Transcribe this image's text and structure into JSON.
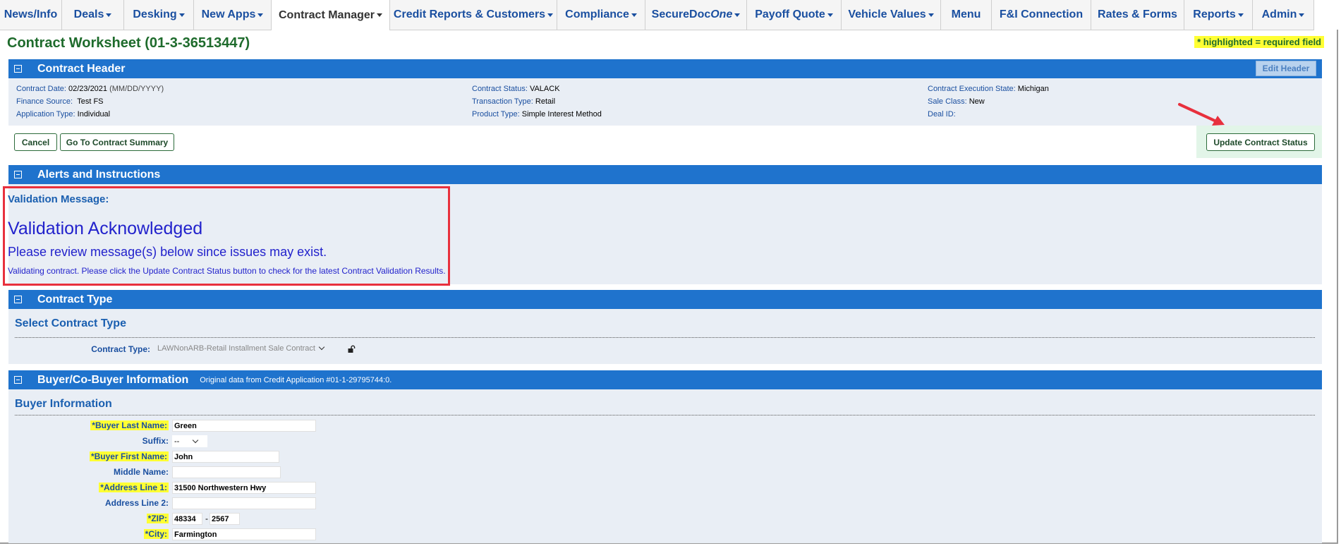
{
  "nav": {
    "items": [
      {
        "label": "News/Info",
        "caret": false
      },
      {
        "label": "Deals",
        "caret": true
      },
      {
        "label": "Desking",
        "caret": true
      },
      {
        "label": "New Apps",
        "caret": true
      },
      {
        "label": "Contract Manager",
        "caret": true,
        "active": true
      },
      {
        "label": "Credit Reports & Customers",
        "caret": true
      },
      {
        "label": "Compliance",
        "caret": true
      },
      {
        "label": "SecureDoc",
        "label_italic": "One",
        "caret": true
      },
      {
        "label": "Payoff Quote",
        "caret": true
      },
      {
        "label": "Vehicle Values",
        "caret": true
      },
      {
        "label": "Menu",
        "caret": false
      },
      {
        "label": "F&I Connection",
        "caret": false
      },
      {
        "label": "Rates & Forms",
        "caret": false
      },
      {
        "label": "Reports",
        "caret": true
      },
      {
        "label": "Admin",
        "caret": true
      }
    ]
  },
  "page": {
    "title": "Contract Worksheet (01-3-36513447)",
    "required_note": "* highlighted = required field"
  },
  "contract_header": {
    "section_title": "Contract Header",
    "edit_button": "Edit Header",
    "col1": [
      {
        "label": "Contract Date:",
        "value": "02/23/2021",
        "hint": "(MM/DD/YYYY)"
      },
      {
        "label": "Finance Source:",
        "value": "Test FS"
      },
      {
        "label": "Application Type:",
        "value": "Individual"
      }
    ],
    "col2": [
      {
        "label": "Contract Status:",
        "value": "VALACK"
      },
      {
        "label": "Transaction Type:",
        "value": "Retail"
      },
      {
        "label": "Product Type:",
        "value": "Simple Interest Method"
      }
    ],
    "col3": [
      {
        "label": "Contract Execution State:",
        "value": "Michigan"
      },
      {
        "label": "Sale Class:",
        "value": "New"
      },
      {
        "label": "Deal ID:",
        "value": ""
      }
    ]
  },
  "actions": {
    "cancel": "Cancel",
    "go_summary": "Go To Contract Summary",
    "update_status": "Update Contract Status"
  },
  "alerts": {
    "section_title": "Alerts and Instructions",
    "validation_label": "Validation Message:",
    "validation_status": "Validation Acknowledged",
    "review_message": "Please review message(s) below since issues may exist.",
    "detail_message": "Validating contract. Please click the Update Contract Status button to check for the latest Contract Validation Results."
  },
  "contract_type": {
    "section_title": "Contract Type",
    "subheading": "Select Contract Type",
    "field_label": "Contract Type:",
    "selected": "LAWNonARB-Retail Installment Sale Contract"
  },
  "buyer": {
    "section_title": "Buyer/Co-Buyer Information",
    "section_note": "Original data from Credit Application #01-1-29795744:0.",
    "subheading": "Buyer Information",
    "last_name_label": "*Buyer Last Name:",
    "last_name": "Green",
    "suffix_label": "Suffix:",
    "suffix": "--",
    "first_name_label": "*Buyer First Name:",
    "first_name": "John",
    "middle_name_label": "Middle Name:",
    "middle_name": "",
    "address1_label": "*Address Line 1:",
    "address1": "31500 Northwestern Hwy",
    "address2_label": "Address Line 2:",
    "address2": "",
    "zip_label": "*ZIP:",
    "zip": "48334",
    "zip_dash": "-",
    "zip_ext": "2567",
    "city_label": "*City:",
    "city": "Farmington"
  }
}
